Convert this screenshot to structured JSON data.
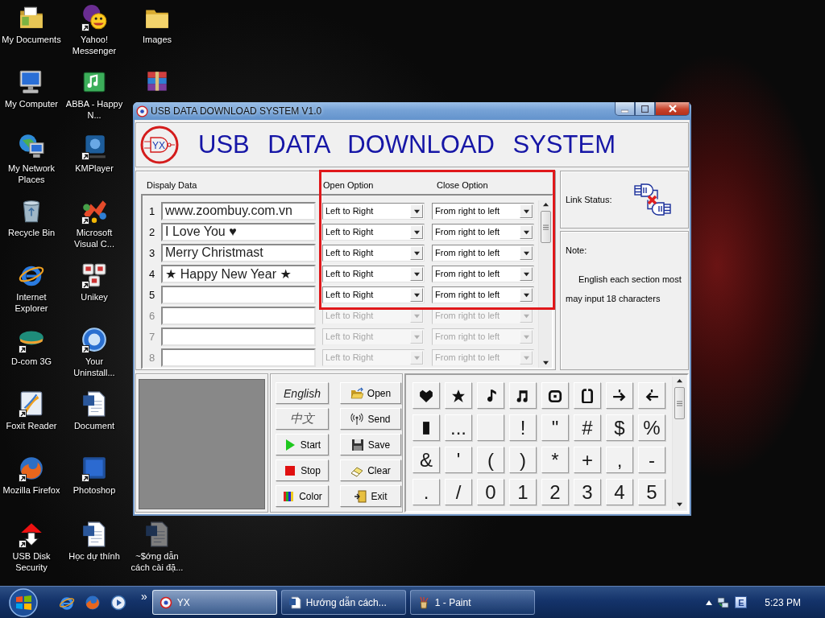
{
  "desktop": {
    "icon_columns": [
      [
        {
          "label": "My Documents",
          "kind": "documents",
          "shortcut": false,
          "ghosted": false
        },
        {
          "label": "My Computer",
          "kind": "computer",
          "shortcut": false,
          "ghosted": false
        },
        {
          "label": "My Network Places",
          "kind": "network",
          "shortcut": false,
          "ghosted": false
        },
        {
          "label": "Recycle Bin",
          "kind": "recycle",
          "shortcut": false,
          "ghosted": false
        },
        {
          "label": "Internet Explorer",
          "kind": "browser",
          "shortcut": false,
          "ghosted": false
        },
        {
          "label": "D-com 3G",
          "kind": "modem",
          "shortcut": true,
          "ghosted": false
        },
        {
          "label": "Foxit Reader",
          "kind": "reader",
          "shortcut": true,
          "ghosted": false
        },
        {
          "label": "Mozilla Firefox",
          "kind": "fox",
          "shortcut": true,
          "ghosted": false
        },
        {
          "label": "USB Disk Security",
          "kind": "usb",
          "shortcut": true,
          "ghosted": false
        }
      ],
      [
        {
          "label": "Yahoo! Messenger",
          "kind": "messenger",
          "shortcut": true,
          "ghosted": false
        },
        {
          "label": "ABBA - Happy N...",
          "kind": "music",
          "shortcut": false,
          "ghosted": false
        },
        {
          "label": "KMPlayer",
          "kind": "player",
          "shortcut": true,
          "ghosted": false
        },
        {
          "label": "Microsoft Visual C...",
          "kind": "studio",
          "shortcut": true,
          "ghosted": false
        },
        {
          "label": "Unikey",
          "kind": "keyboard",
          "shortcut": true,
          "ghosted": false
        },
        {
          "label": "Your Uninstall...",
          "kind": "uninstaller",
          "shortcut": true,
          "ghosted": false
        },
        {
          "label": "Document",
          "kind": "doc",
          "shortcut": false,
          "ghosted": false
        },
        {
          "label": "Photoshop",
          "kind": "editor",
          "shortcut": true,
          "ghosted": false
        },
        {
          "label": "Học dự thính",
          "kind": "doc",
          "shortcut": false,
          "ghosted": false
        }
      ],
      [
        {
          "label": "Images",
          "kind": "folder",
          "shortcut": false,
          "ghosted": false
        },
        {
          "kind": "archive",
          "shortcut": false,
          "ghosted": false
        },
        {
          "label": "~$ớng dẫn cách cài đặ...",
          "kind": "doc",
          "shortcut": false,
          "ghosted": true
        }
      ]
    ]
  },
  "window": {
    "title": "USB DATA DOWNLOAD SYSTEM V1.0",
    "logo_text": "YX",
    "heading": "USB DATA DOWNLOAD SYSTEM",
    "columns": [
      "Dispaly Data",
      "Open Option",
      "Close Option"
    ],
    "rows": [
      {
        "number": "1",
        "text": "www.zoombuy.com.vn",
        "open": "Left to Right",
        "close": "From right to left",
        "disabled": false
      },
      {
        "number": "2",
        "text": "I Love You ♥",
        "open": "Left to Right",
        "close": "From right to left",
        "disabled": false
      },
      {
        "number": "3",
        "text": "Merry Christmast",
        "open": "Left to Right",
        "close": "From right to left",
        "disabled": false
      },
      {
        "number": "4",
        "text": "★ Happy New Year ★",
        "open": "Left to Right",
        "close": "From right to left",
        "disabled": false
      },
      {
        "number": "5",
        "open": "Left to Right",
        "close": "From right to left",
        "disabled": false
      },
      {
        "number": "6",
        "open": "Left to Right",
        "close": "From right to left",
        "disabled": true
      },
      {
        "number": "7",
        "open": "Left to Right",
        "close": "From right to left",
        "disabled": true
      },
      {
        "number": "8",
        "open": "Left to Right",
        "close": "From right to left",
        "disabled": true
      }
    ],
    "link_status": {
      "label": "Link Status:",
      "linked": false
    },
    "note": {
      "title": "Note:",
      "text": "English each section most may input 18 characters"
    },
    "buttons": [
      {
        "label": "English",
        "kind": "english"
      },
      {
        "label": "Open",
        "kind": "open"
      },
      {
        "label": "中文",
        "kind": "chinese"
      },
      {
        "label": "Send",
        "kind": "send"
      },
      {
        "label": "Start",
        "kind": "start"
      },
      {
        "label": "Save",
        "kind": "save"
      },
      {
        "label": "Stop",
        "kind": "stop"
      },
      {
        "label": "Clear",
        "kind": "clear"
      },
      {
        "label": "Color",
        "kind": "color"
      },
      {
        "label": "Exit",
        "kind": "exit"
      }
    ],
    "keys": [
      {
        "kind": "icon"
      },
      {
        "kind": "icon"
      },
      {
        "kind": "icon"
      },
      {
        "kind": "icon"
      },
      {
        "kind": "icon"
      },
      {
        "kind": "icon"
      },
      {
        "kind": "icon"
      },
      {
        "kind": "icon"
      },
      {
        "kind": "icon"
      },
      {
        "kind": "text",
        "label": "..."
      },
      {
        "kind": "blank"
      },
      {
        "kind": "text",
        "label": "!"
      },
      {
        "kind": "text",
        "label": "\""
      },
      {
        "kind": "text",
        "label": "#"
      },
      {
        "kind": "text",
        "label": "$"
      },
      {
        "kind": "text",
        "label": "%"
      },
      {
        "kind": "text",
        "label": "&"
      },
      {
        "kind": "text",
        "label": "'"
      },
      {
        "kind": "text",
        "label": "("
      },
      {
        "kind": "text",
        "label": ")"
      },
      {
        "kind": "text",
        "label": "*"
      },
      {
        "kind": "text",
        "label": "+"
      },
      {
        "kind": "text",
        "label": ","
      },
      {
        "kind": "text",
        "label": "-"
      },
      {
        "kind": "text",
        "label": "."
      },
      {
        "kind": "text",
        "label": "/"
      },
      {
        "kind": "text",
        "label": "0"
      },
      {
        "kind": "text",
        "label": "1"
      },
      {
        "kind": "text",
        "label": "2"
      },
      {
        "kind": "text",
        "label": "3"
      },
      {
        "kind": "text",
        "label": "4"
      },
      {
        "kind": "text",
        "label": "5"
      }
    ]
  },
  "annotation_frame": true,
  "taskbar": {
    "quick_launch": [
      {
        "kind": "browser"
      },
      {
        "kind": "fox"
      },
      {
        "kind": "media"
      }
    ],
    "more": "»",
    "tasks": [
      {
        "label": "YX",
        "kind": "app",
        "selected": true
      },
      {
        "label": "Hướng dẫn cách...",
        "kind": "document",
        "selected": false
      },
      {
        "label": "1 - Paint",
        "kind": "paint",
        "selected": false
      }
    ],
    "input_mode": "E",
    "clock": "5:23 PM"
  }
}
